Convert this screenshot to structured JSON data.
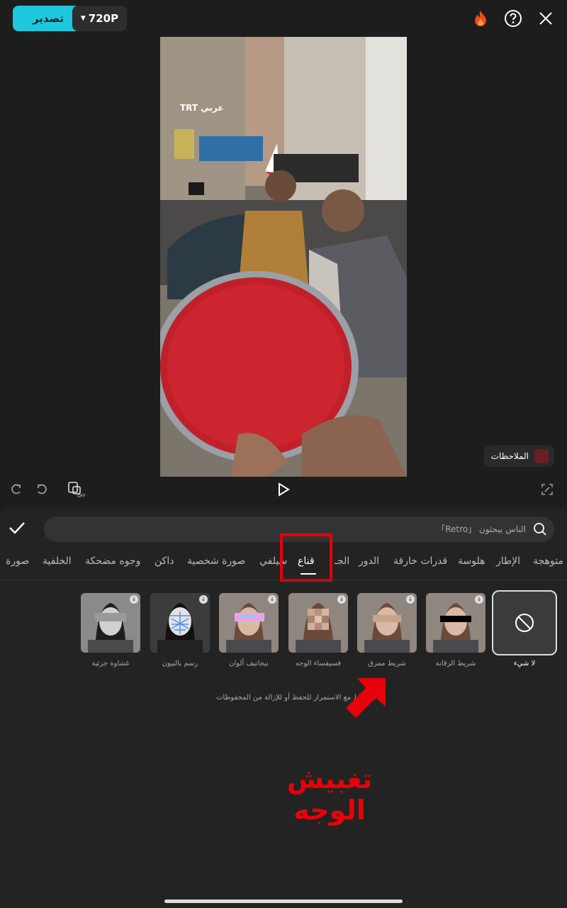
{
  "topbar": {
    "export_label": "تصدير",
    "resolution": "720P"
  },
  "notes": {
    "label": "الملاحظات"
  },
  "video": {
    "watermark": "TRT عربي"
  },
  "search": {
    "placeholder": "الناس يبحثون 「Retro」"
  },
  "categories": [
    {
      "label": "متوهجة"
    },
    {
      "label": "الإطار"
    },
    {
      "label": "هلوسة"
    },
    {
      "label": "قدرات خارقة"
    },
    {
      "label": "الدور"
    },
    {
      "label": "الجـ"
    },
    {
      "label": "قناع"
    },
    {
      "label": "سيلفي"
    },
    {
      "label": "صورة شخصية"
    },
    {
      "label": "داكن"
    },
    {
      "label": "وجوه مضحكة"
    },
    {
      "label": "الخلفية"
    },
    {
      "label": "صورة"
    }
  ],
  "active_category": "قناع",
  "effects": [
    {
      "label": "لا شيء"
    },
    {
      "label": "شريط الرقابة"
    },
    {
      "label": "شريط ممزق"
    },
    {
      "label": "فسيفساء الوجه"
    },
    {
      "label": "نيجاتيف ألوان"
    },
    {
      "label": "رسم بالنيون"
    },
    {
      "label": "غشاوة جزئية"
    }
  ],
  "hint": "اضغط مع الاستمرار للحفظ أو للإزالة من المحفوظات",
  "annotation": "تغبيش الوجه",
  "colors": {
    "accent": "#1ec8dc",
    "highlight": "#e8000a",
    "panel": "#232323"
  }
}
